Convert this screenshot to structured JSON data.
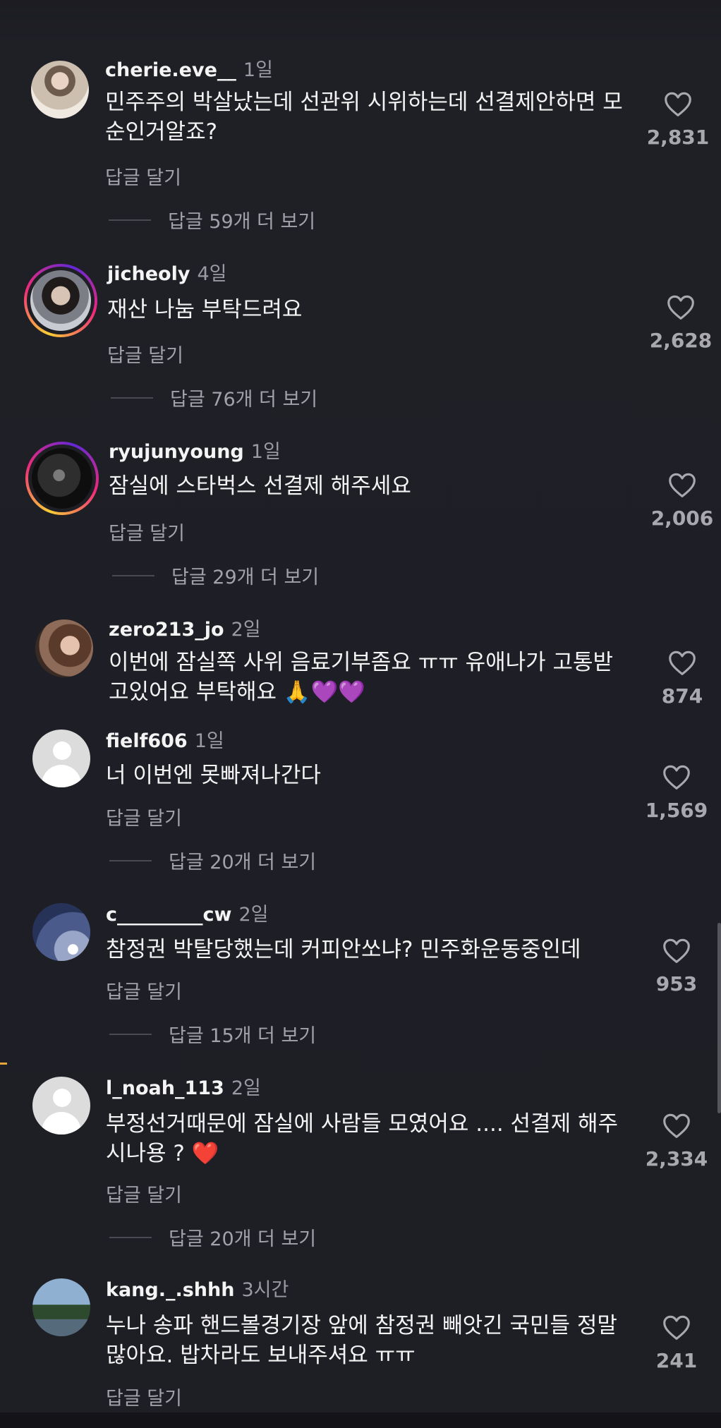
{
  "comments": [
    {
      "username": "cherie.eve__",
      "time": "1일",
      "text": "민주주의 박살났는데 선관위 시위하는데 선결제안하면 모순인거알죠?",
      "reply_label": "답글 달기",
      "view_replies": "답글 59개 더 보기",
      "likes": "2,831"
    },
    {
      "username": "jicheoly",
      "time": "4일",
      "text": "재산 나눔 부탁드려요",
      "reply_label": "답글 달기",
      "view_replies": "답글 76개 더 보기",
      "likes": "2,628"
    },
    {
      "username": "ryujunyoung",
      "time": "1일",
      "text": "잠실에 스타벅스 선결제 해주세요",
      "reply_label": "답글 달기",
      "view_replies": "답글 29개 더 보기",
      "likes": "2,006"
    },
    {
      "username": "zero213_jo",
      "time": "2일",
      "text": "이번에 잠실쪽 사위 음료기부좀요 ㅠㅠ 유애나가 고통받고있어요 부탁해요 🙏💜💜",
      "likes": "874"
    },
    {
      "username": "fielf606",
      "time": "1일",
      "text": "너 이번엔 못빠져나간다",
      "reply_label": "답글 달기",
      "view_replies": "답글 20개 더 보기",
      "likes": "1,569"
    },
    {
      "username": "c_________cw",
      "time": "2일",
      "text": "참정권 박탈당했는데 커피안쏘냐? 민주화운동중인데",
      "reply_label": "답글 달기",
      "view_replies": "답글 15개 더 보기",
      "likes": "953"
    },
    {
      "username": "l_noah_113",
      "time": "2일",
      "text": "부정선거때문에 잠실에 사람들 모였어요 .... 선결제 해주시나용 ? ❤️",
      "reply_label": "답글 달기",
      "view_replies": "답글 20개 더 보기",
      "likes": "2,334"
    },
    {
      "username": "kang._.shhh",
      "time": "3시간",
      "text": "누나 송파 핸드볼경기장 앞에 참정권 빼앗긴 국민들 정말 많아요. 밥차라도 보내주셔요 ㅠㅠ",
      "reply_label": "답글 달기",
      "likes": "241"
    }
  ],
  "icons": {
    "like": "heart-outline-icon",
    "default_avatar": "default-user-icon"
  },
  "colors": {
    "background": "#1e1e24",
    "secondary_text": "#a2a2aa",
    "story_ring": "#ee2a7b"
  }
}
